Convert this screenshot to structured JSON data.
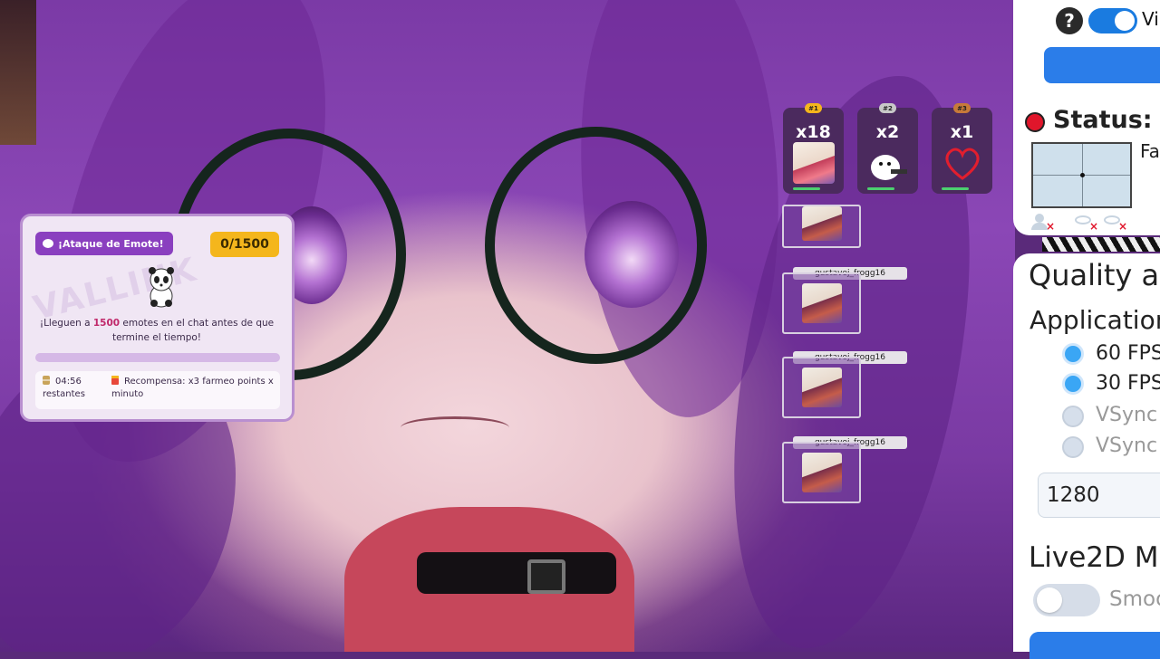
{
  "emote_attack": {
    "badge_label": "¡Ataque de Emote!",
    "counter": "0/1500",
    "watermark": "VALLINK",
    "message_pre": "¡Lleguen a ",
    "message_highlight": "1500",
    "message_post": " emotes en el chat antes de que termine el tiempo!",
    "progress_fraction": 0,
    "time_value": "04:56",
    "time_label": "restantes",
    "reward_text": "Recompensa: x3 farmeo points x minuto"
  },
  "leaderboard": [
    {
      "rank": "#1",
      "count": "x18",
      "rank_color": "#f4b61c",
      "emote_icon": "anime-face-emote"
    },
    {
      "rank": "#2",
      "count": "x2",
      "rank_color": "#c8c8c8",
      "emote_icon": "white-blob-emote"
    },
    {
      "rank": "#3",
      "count": "x1",
      "rank_color": "#c77a3a",
      "emote_icon": "heart-emote"
    }
  ],
  "chat_emotes": [
    {
      "user": ""
    },
    {
      "user": "gustavoj_frogg16"
    },
    {
      "user": "gustavoj_frogg16"
    },
    {
      "user": "gustavoj_frogg16"
    }
  ],
  "settings": {
    "top_toggle_label": "Vi",
    "status_label": "Status:",
    "face_label": "Fa",
    "quality_title": "Quality ar",
    "application_label": "Application",
    "fps_options": [
      {
        "label": "60 FPS",
        "selected": false
      },
      {
        "label": "30 FPS",
        "selected": true
      },
      {
        "label": "VSync",
        "selected": false
      },
      {
        "label": "VSync",
        "selected": false
      }
    ],
    "resolution_value": "1280",
    "live2d_title": "Live2D Ma",
    "smooth_label": "Smoo"
  },
  "colors": {
    "accent_blue": "#2b7de9",
    "status_red": "#e0162b",
    "widget_purple": "#8a3fbf",
    "counter_gold": "#f4b61c"
  }
}
